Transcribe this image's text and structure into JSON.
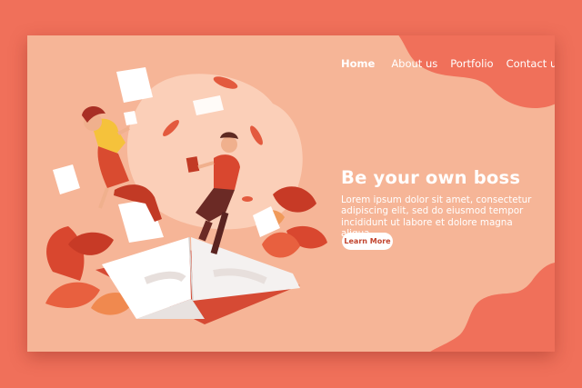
{
  "nav": {
    "items": [
      {
        "label": "Home"
      },
      {
        "label": "About us"
      },
      {
        "label": "Portfolio"
      },
      {
        "label": "Contact us"
      }
    ]
  },
  "hero": {
    "title": "Be your own boss",
    "description": "Lorem ipsum dolor sit amet, consectetur adipiscing elit, sed do eiusmod tempor incididunt ut labore et dolore magna aliqua.",
    "button_label": "Learn More"
  },
  "colors": {
    "page_background": "#f0705a",
    "card_background": "#f6b597",
    "accent": "#f0705a",
    "button_text": "#c2452f"
  }
}
